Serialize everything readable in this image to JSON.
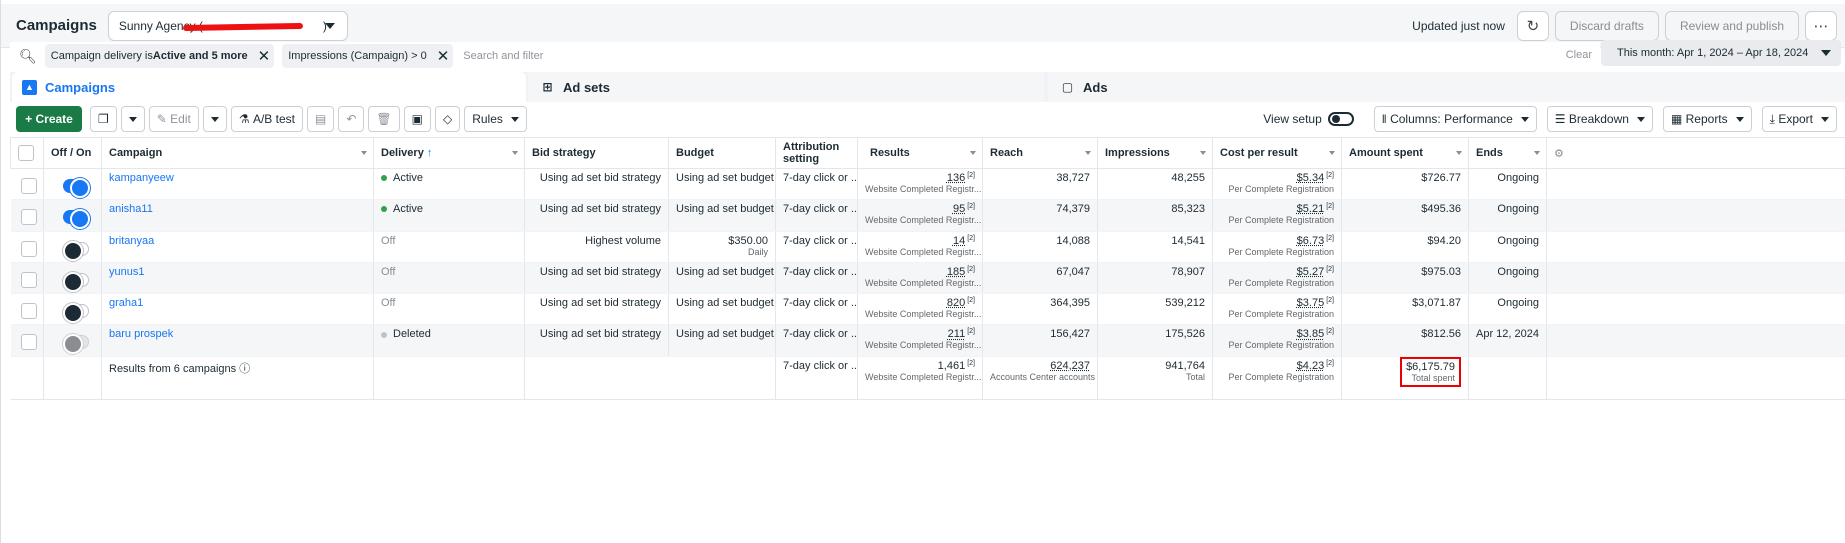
{
  "header": {
    "title": "Campaigns",
    "account": "Sunny Agency (",
    "account_close": ")",
    "updated": "Updated just now",
    "discard": "Discard drafts",
    "review": "Review and publish",
    "more": "⋯"
  },
  "filters": {
    "chip1_prefix": "Campaign delivery is ",
    "chip1_bold": "Active and 5 more",
    "chip2": "Impressions (Campaign) > 0",
    "search_placeholder": "Search and filter",
    "clear": "Clear",
    "date": "This month: Apr 1, 2024 – Apr 18, 2024"
  },
  "tabs": {
    "campaigns": "Campaigns",
    "adsets": "Ad sets",
    "ads": "Ads"
  },
  "toolbar": {
    "create": "+ Create",
    "edit": "Edit",
    "abtest": "A/B test",
    "rules": "Rules",
    "view_setup": "View setup",
    "columns": "Columns: Performance",
    "breakdown": "Breakdown",
    "reports": "Reports",
    "export": "Export"
  },
  "columns": {
    "offon": "Off / On",
    "campaign": "Campaign",
    "delivery": "Delivery",
    "bid": "Bid strategy",
    "budget": "Budget",
    "attribution": "Attribution setting",
    "results": "Results",
    "reach": "Reach",
    "impressions": "Impressions",
    "cpr": "Cost per result",
    "spent": "Amount spent",
    "ends": "Ends"
  },
  "rows": [
    {
      "name": "kampanyeew",
      "toggle": "on",
      "delivery": "Active",
      "bid": "Using ad set bid strategy",
      "budget": "Using ad set budget",
      "budget_sub": "",
      "attr": "7-day click or ...",
      "results": "136",
      "results_sub": "Website Completed Registr...",
      "reach": "38,727",
      "impr": "48,255",
      "cpr": "$5.34",
      "cpr_sub": "Per Complete Registration",
      "spent": "$726.77",
      "ends": "Ongoing"
    },
    {
      "name": "anisha11",
      "toggle": "on",
      "delivery": "Active",
      "bid": "Using ad set bid strategy",
      "budget": "Using ad set budget",
      "budget_sub": "",
      "attr": "7-day click or ...",
      "results": "95",
      "results_sub": "Website Completed Registr...",
      "reach": "74,379",
      "impr": "85,323",
      "cpr": "$5.21",
      "cpr_sub": "Per Complete Registration",
      "spent": "$495.36",
      "ends": "Ongoing"
    },
    {
      "name": "britanyaa",
      "toggle": "off",
      "delivery": "Off",
      "bid": "Highest volume",
      "budget": "$350.00",
      "budget_sub": "Daily",
      "attr": "7-day click or ...",
      "results": "14",
      "results_sub": "Website Completed Registr...",
      "reach": "14,088",
      "impr": "14,541",
      "cpr": "$6.73",
      "cpr_sub": "Per Complete Registration",
      "spent": "$94.20",
      "ends": "Ongoing"
    },
    {
      "name": "yunus1",
      "toggle": "off",
      "delivery": "Off",
      "bid": "Using ad set bid strategy",
      "budget": "Using ad set budget",
      "budget_sub": "",
      "attr": "7-day click or ...",
      "results": "185",
      "results_sub": "Website Completed Registr...",
      "reach": "67,047",
      "impr": "78,907",
      "cpr": "$5.27",
      "cpr_sub": "Per Complete Registration",
      "spent": "$975.03",
      "ends": "Ongoing"
    },
    {
      "name": "graha1",
      "toggle": "off",
      "delivery": "Off",
      "bid": "Using ad set bid strategy",
      "budget": "Using ad set budget",
      "budget_sub": "",
      "attr": "7-day click or ...",
      "results": "820",
      "results_sub": "Website Completed Registr...",
      "reach": "364,395",
      "impr": "539,212",
      "cpr": "$3.75",
      "cpr_sub": "Per Complete Registration",
      "spent": "$3,071.87",
      "ends": "Ongoing"
    },
    {
      "name": "baru prospek",
      "toggle": "dis",
      "delivery": "Deleted",
      "bid": "Using ad set bid strategy",
      "budget": "Using ad set budget",
      "budget_sub": "",
      "attr": "7-day click or ...",
      "results": "211",
      "results_sub": "Website Completed Registr...",
      "reach": "156,427",
      "impr": "175,526",
      "cpr": "$3.85",
      "cpr_sub": "Per Complete Registration",
      "spent": "$812.56",
      "ends": "Apr 12, 2024"
    }
  ],
  "totals": {
    "label": "Results from 6 campaigns",
    "attr": "7-day click or ...",
    "results": "1,461",
    "results_sub": "Website Completed Registr...",
    "reach": "624,237",
    "reach_sub": "Accounts Center accounts",
    "impr": "941,764",
    "impr_sub": "Total",
    "cpr": "$4.23",
    "cpr_sub": "Per Complete Registration",
    "spent": "$6,175.79",
    "spent_sub": "Total spent"
  },
  "superscript": "[2]"
}
